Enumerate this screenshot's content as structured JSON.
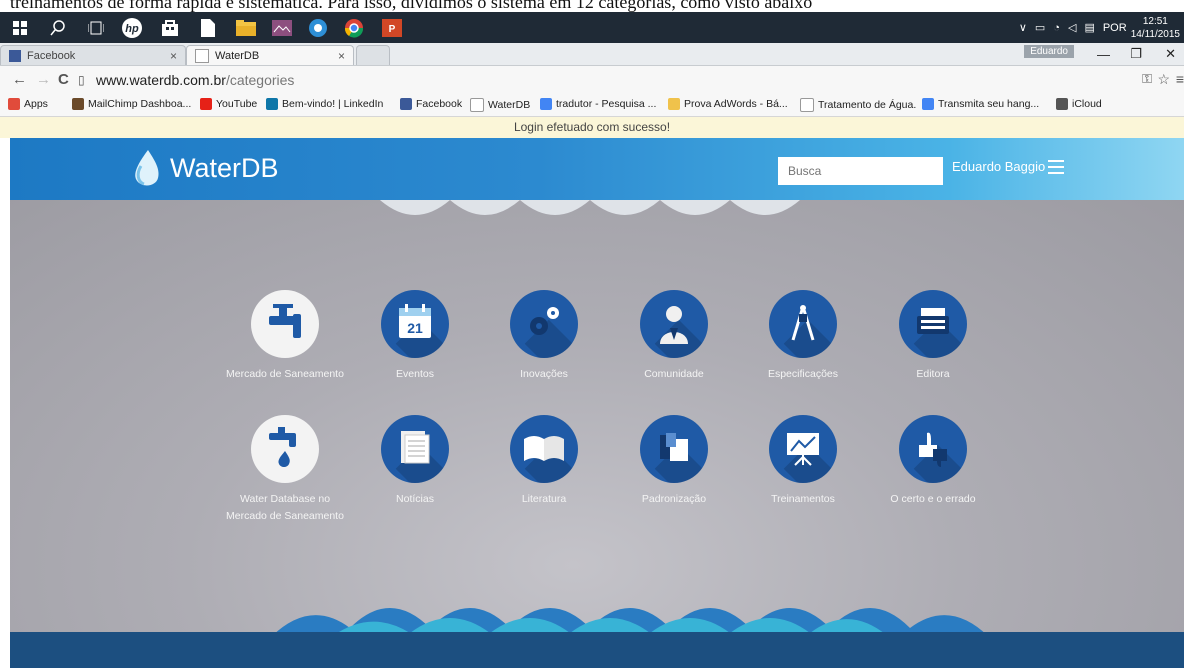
{
  "doc_text": "treinamentos de forma rápida e sistemática. Para isso, dividimos o sistema em 12 categorias, como visto abaixo",
  "taskbar": {
    "icons": [
      "windows-icon",
      "search-icon",
      "task-view-icon",
      "hp-icon",
      "store-icon",
      "file-icon",
      "file-explorer-icon",
      "photo-app-icon",
      "app-icon",
      "chrome-icon",
      "powerpoint-icon"
    ],
    "language": "POR",
    "time": "12:51",
    "date": "14/11/2015"
  },
  "browser": {
    "tabs": [
      {
        "label": "Facebook",
        "active": false
      },
      {
        "label": "WaterDB",
        "active": true
      }
    ],
    "user": "Eduardo",
    "url_host": "www.waterdb.com.br",
    "url_path": "/categories",
    "bookmarks": [
      {
        "label": "Apps",
        "icon": "apps-icon",
        "color": "#e14b3b"
      },
      {
        "label": "MailChimp Dashboa...",
        "icon": "mailchimp-icon",
        "color": "#6b4a2a"
      },
      {
        "label": "YouTube",
        "icon": "youtube-icon",
        "color": "#e62117"
      },
      {
        "label": "Bem-vindo! | LinkedIn",
        "icon": "linkedin-icon",
        "color": "#0e76a8"
      },
      {
        "label": "Facebook",
        "icon": "facebook-icon",
        "color": "#3b5998"
      },
      {
        "label": "WaterDB",
        "icon": "page-icon",
        "color": "#ffffff"
      },
      {
        "label": "tradutor - Pesquisa ...",
        "icon": "google-icon",
        "color": "#4285f4"
      },
      {
        "label": "Prova AdWords - Bá...",
        "icon": "folder-icon",
        "color": "#f0c24b"
      },
      {
        "label": "Tratamento de Água.",
        "icon": "page-icon",
        "color": "#ffffff"
      },
      {
        "label": "Transmita seu hang...",
        "icon": "google-icon",
        "color": "#4285f4"
      },
      {
        "label": "iCloud",
        "icon": "apple-icon",
        "color": "#555555"
      }
    ],
    "notice": "Login efetuado com sucesso!"
  },
  "site": {
    "logo_bold": "Water",
    "logo_rest": "DB",
    "search_placeholder": "Busca",
    "user_name": "Eduardo Baggio",
    "categories": [
      {
        "label": "Mercado de Saneamento",
        "icon": "faucet-icon",
        "white": true
      },
      {
        "label": "Eventos",
        "icon": "calendar-icon",
        "white": false,
        "badge": "21"
      },
      {
        "label": "Inovações",
        "icon": "gears-icon",
        "white": false
      },
      {
        "label": "Comunidade",
        "icon": "person-icon",
        "white": false
      },
      {
        "label": "Especificações",
        "icon": "compass-icon",
        "white": false
      },
      {
        "label": "Editora",
        "icon": "typewriter-icon",
        "white": false
      },
      {
        "label": "Water Database no Mercado de Saneamento",
        "icon": "faucet-drop-icon",
        "white": true
      },
      {
        "label": "Notícias",
        "icon": "newspaper-icon",
        "white": false
      },
      {
        "label": "Literatura",
        "icon": "book-icon",
        "white": false
      },
      {
        "label": "Padronização",
        "icon": "cubes-icon",
        "white": false
      },
      {
        "label": "Treinamentos",
        "icon": "presentation-board-icon",
        "white": false
      },
      {
        "label": "O certo e o errado",
        "icon": "thumbs-icon",
        "white": false
      }
    ]
  },
  "colors": {
    "brand_blue": "#1f5aa6",
    "header_blue": "#1d79c4",
    "page_gray": "#aeadb4"
  }
}
